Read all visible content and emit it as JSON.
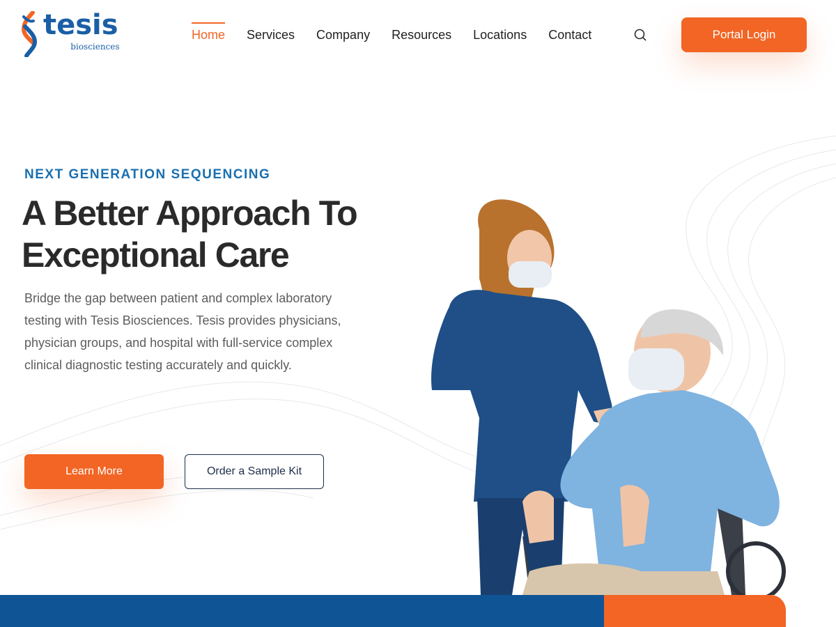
{
  "brand": {
    "name": "tesis",
    "subname": "biosciences",
    "primary_color": "#1a5fa6",
    "accent_color": "#f26524",
    "dark_blue": "#0f5596"
  },
  "nav": {
    "items": [
      {
        "label": "Home",
        "active": true
      },
      {
        "label": "Services",
        "active": false
      },
      {
        "label": "Company",
        "active": false
      },
      {
        "label": "Resources",
        "active": false
      },
      {
        "label": "Locations",
        "active": false
      },
      {
        "label": "Contact",
        "active": false
      }
    ],
    "search_icon": "search-icon",
    "portal_label": "Portal Login"
  },
  "hero": {
    "eyebrow": "NEXT GENERATION SEQUENCING",
    "title_line1": "A Better Approach To",
    "title_line2": "Exceptional Care",
    "body": "Bridge the gap between patient and complex laboratory testing with Tesis Biosciences. Tesis provides physicians, physician groups, and hospital with full-service complex clinical diagnostic testing accurately and quickly.",
    "primary_cta": "Learn More",
    "secondary_cta": "Order a Sample Kit"
  }
}
